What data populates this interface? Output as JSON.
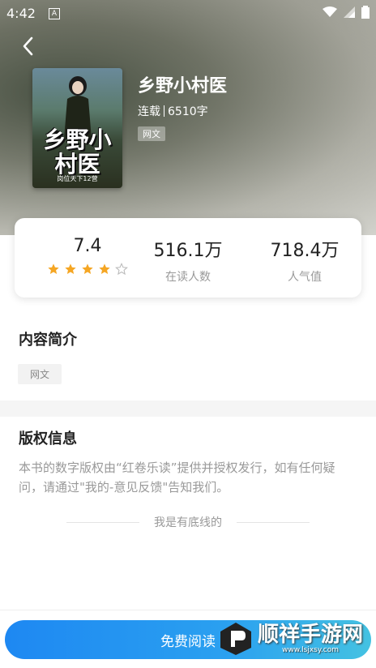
{
  "status_bar": {
    "time": "4:42",
    "notification_icon": "A"
  },
  "book": {
    "title": "乡野小村医",
    "status": "连载",
    "word_count": "6510字",
    "tag": "网文",
    "cover_title": "乡野小村医",
    "cover_subtitle": "岗位天下12营"
  },
  "stats": {
    "rating": "7.4",
    "stars_filled": 4,
    "stars_total": 5,
    "readers_value": "516.1万",
    "readers_label": "在读人数",
    "popularity_value": "718.4万",
    "popularity_label": "人气值"
  },
  "intro": {
    "title": "内容简介",
    "tag": "网文"
  },
  "copyright": {
    "title": "版权信息",
    "text": "本书的数字版权由“红卷乐读”提供并授权发行，如有任何疑问，请通过\"我的-意见反馈\"告知我们。"
  },
  "bottom_text": "我是有底线的",
  "read_button": "免费阅读",
  "watermark": {
    "name": "顺祥手游网",
    "url": "www.lsjxsy.com"
  },
  "colors": {
    "accent": "#1e88f2",
    "star": "#f5a623"
  }
}
